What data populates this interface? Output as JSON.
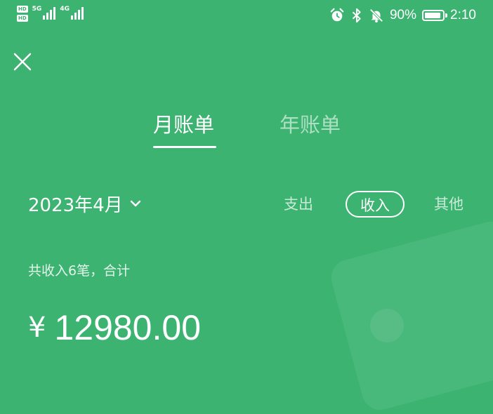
{
  "status_bar": {
    "hd_badges": [
      "HD",
      "HD"
    ],
    "network_labels": [
      "5G",
      "4G"
    ],
    "battery_level_percent": 90,
    "battery_text": "90%",
    "time": "2:10",
    "icons": [
      "alarm-icon",
      "bluetooth-icon",
      "mute-bell-icon",
      "battery-icon"
    ]
  },
  "header": {
    "close_icon": "close-icon"
  },
  "tabs": [
    {
      "label": "月账单",
      "active": true
    },
    {
      "label": "年账单",
      "active": false
    }
  ],
  "period": {
    "label": "2023年4月",
    "icon": "chevron-down-icon"
  },
  "filters": [
    {
      "label": "支出",
      "selected": false
    },
    {
      "label": "收入",
      "selected": true
    },
    {
      "label": "其他",
      "selected": false
    }
  ],
  "summary": {
    "text": "共收入6笔，合计",
    "currency": "¥",
    "amount": "12980.00"
  },
  "colors": {
    "background": "#3cb371",
    "foreground": "#ffffff"
  }
}
